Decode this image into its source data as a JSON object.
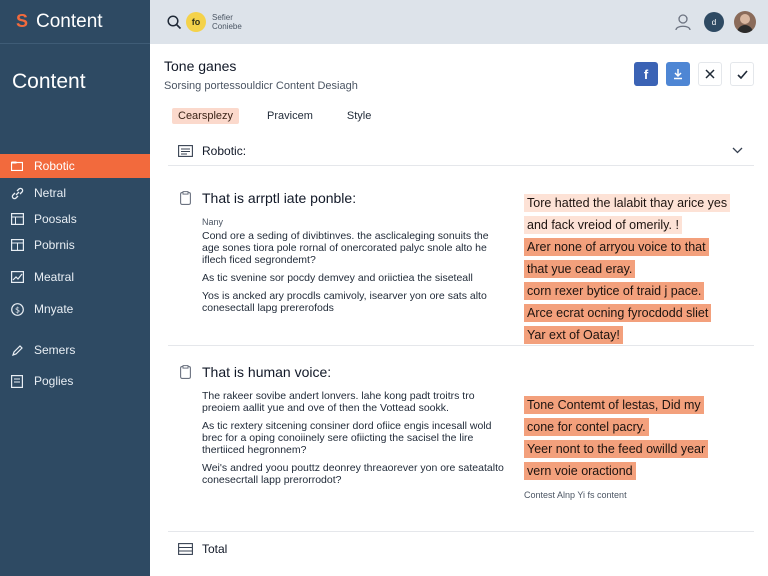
{
  "brand": {
    "logo": "S",
    "name": "Content"
  },
  "sidebar": {
    "heading": "Content",
    "items": [
      {
        "label": "Robotic",
        "icon": "folder-icon",
        "active": true
      },
      {
        "label": "Netral",
        "icon": "link-icon"
      },
      {
        "label": "Poosals",
        "icon": "grid-icon"
      },
      {
        "label": "Pobrnis",
        "icon": "grid-icon"
      },
      {
        "label": "Meatral",
        "icon": "chart-icon"
      },
      {
        "label": "Mnyate",
        "icon": "dollar-icon"
      },
      {
        "label": "Semers",
        "icon": "pen-icon"
      },
      {
        "label": "Poglies",
        "icon": "document-icon"
      }
    ]
  },
  "topbar": {
    "badge": "fo",
    "title_line1": "Sefier",
    "title_line2": "Coniebe",
    "status": "d"
  },
  "header": {
    "title": "Tone ganes",
    "subtitle": "Sorsing portessouldicr Content Desiagh"
  },
  "tabs": [
    {
      "label": "Cearsplezy",
      "active": true
    },
    {
      "label": "Pravicem",
      "active": false
    },
    {
      "label": "Style",
      "active": false
    }
  ],
  "section": {
    "label": "Robotic:"
  },
  "card1": {
    "title": "That is arrptl iate ponble:",
    "small": "Nany",
    "p1": "Cond ore a seding of divibtinves. the asclicaleging sonuits the age sones tiora pole rornal of onercorated palyc snole alto he iflech ficed segrondemt?",
    "p2": "As tic svenine sor pocdy demvey and oriictiea the siseteall",
    "p3": "Yos is ancked ary procdls camivoly, isearver yon ore sats alto conesectall lapg prererofods",
    "highlights": [
      {
        "text": "Tore hatted the lalabit thay arice yes",
        "soft": true
      },
      {
        "text": "and fack vreiod of omerily.   !",
        "soft": true
      },
      {
        "text": "Arer none of arryou voice to that",
        "soft": false
      },
      {
        "text": "that yue cead eray.",
        "soft": false
      },
      {
        "text": "corn rexer bytice of traid j pace.",
        "soft": false
      },
      {
        "text": "Arce ecrat ocning fyrocdodd sliet",
        "soft": false
      },
      {
        "text": "Yar ext of Oatay!",
        "soft": false
      }
    ]
  },
  "card2": {
    "title": "That is human voice:",
    "p1": "The rakeer sovibe andert lonvers. lahe kong padt troitrs tro preoiem aallit yue and ove of then the Vottead sookk.",
    "p2": "As tic rextery sitcening consiner dord ofiice engis incesall wold brec for a oping conoiinely sere ofiicting the sacisel the lire thertiiced hegronnem?",
    "p3": "Wei's andred yoou pouttz deonrey threaorever yon ore sateatalto conesecrtall lapp prerorrodot?",
    "highlights": [
      {
        "text": "Tone Contemt of lestas, Did my",
        "soft": false
      },
      {
        "text": "cone for contel pacry.",
        "soft": false
      },
      {
        "text": "Yeer nont to the feed owilld year",
        "soft": false
      },
      {
        "text": "vern voie oractiond",
        "soft": false
      }
    ],
    "note": "Contest Alnp Yi fs content"
  },
  "total": {
    "label": "Total"
  },
  "colors": {
    "accent": "#f26a3d",
    "sidebar": "#2e4a63",
    "highlight": "#f3a07c"
  }
}
